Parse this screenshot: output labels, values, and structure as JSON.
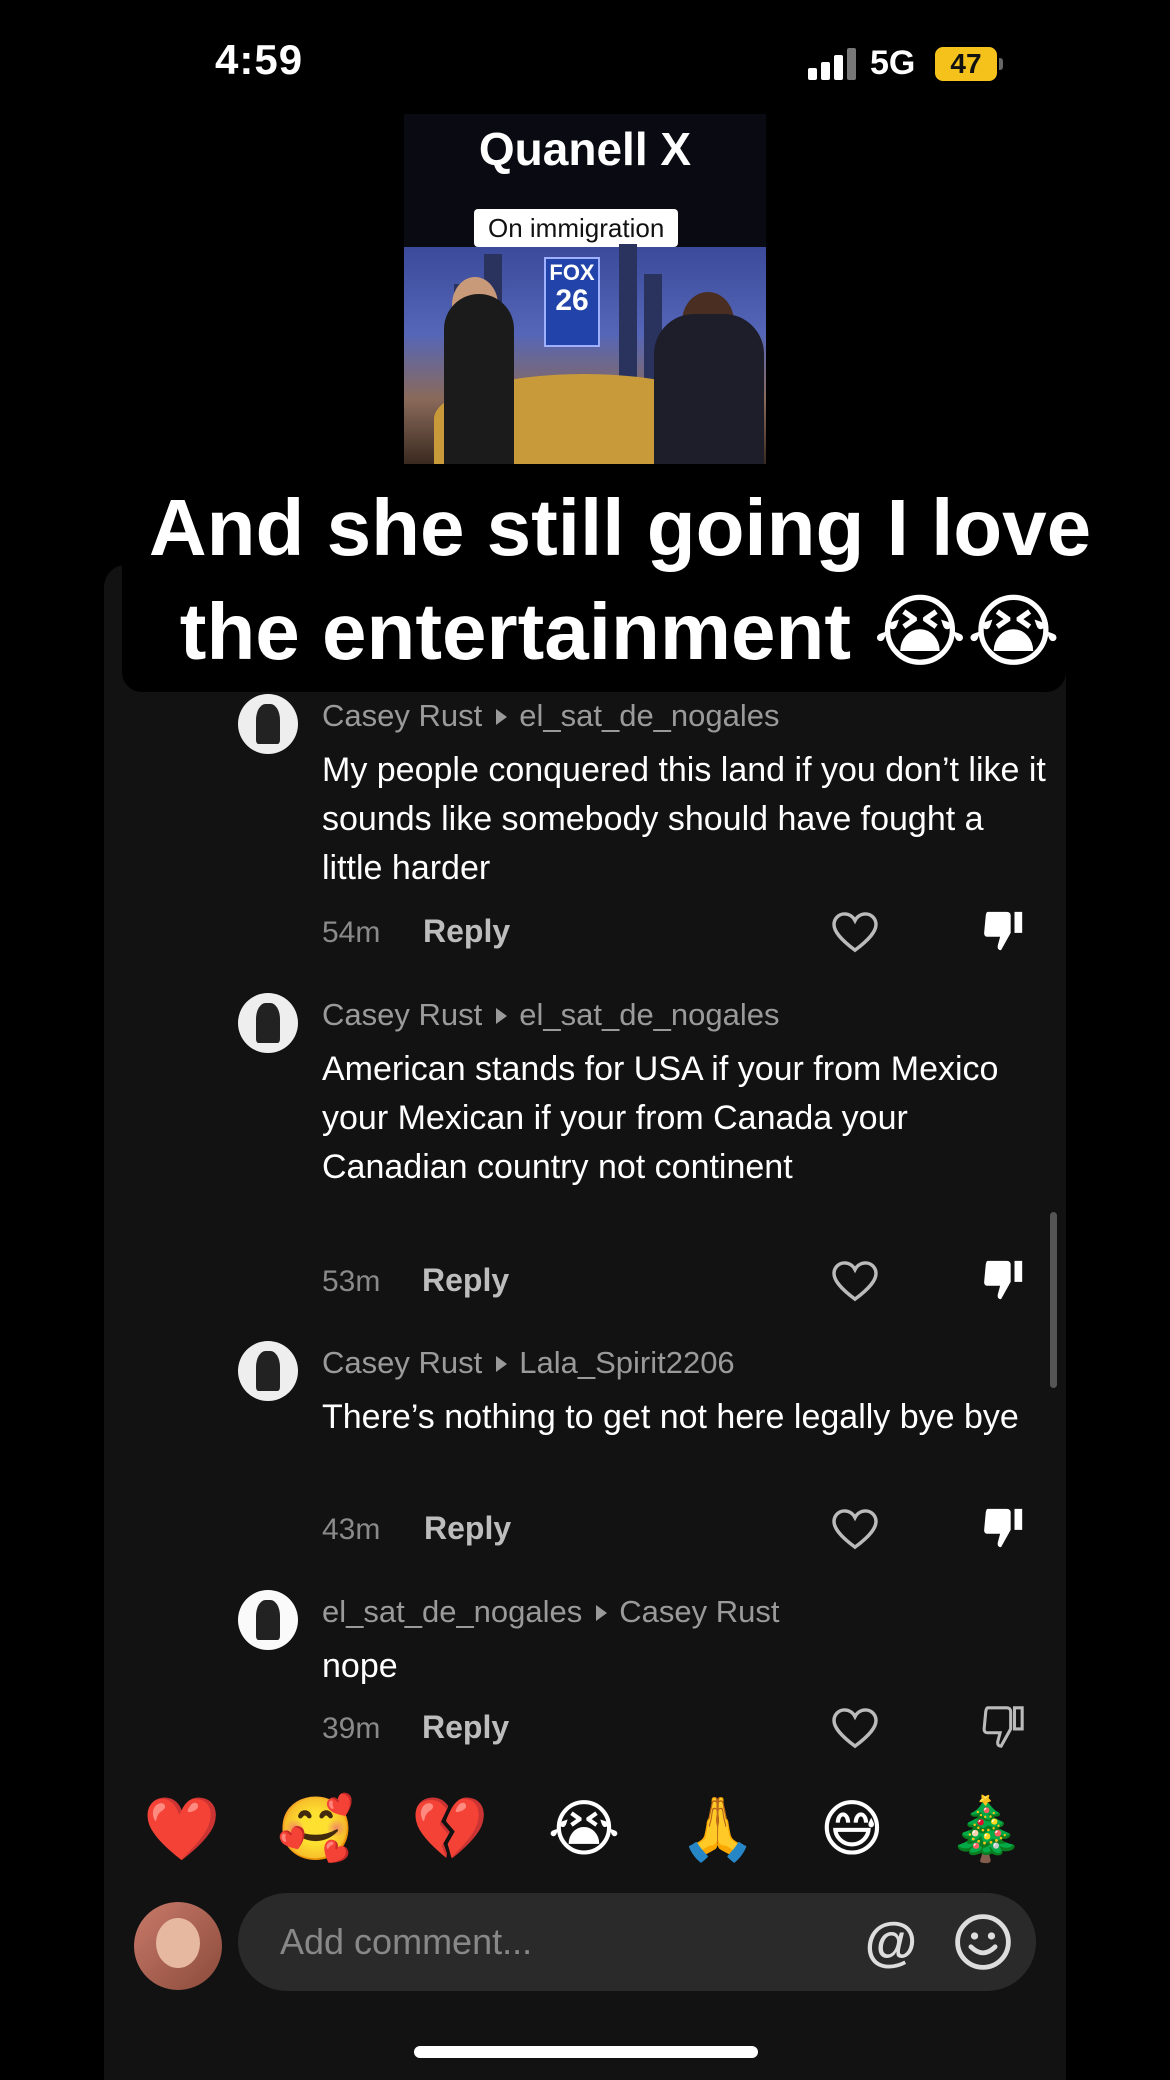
{
  "status_bar": {
    "time": "4:59",
    "network": "5G",
    "battery": "47"
  },
  "video": {
    "title": "Quanell X",
    "tag": "On immigration",
    "station_logo": [
      "FOX",
      "26"
    ]
  },
  "caption": "And she still going I love the entertainment 😭😭",
  "comments": [
    {
      "author": "Casey Rust",
      "reply_to": "el_sat_de_nogales",
      "text": "My people conquered this land if you don’t like it sounds like somebody should have fought a little harder",
      "age": "54m",
      "reply_label": "Reply",
      "avatar_icon": "profile-photo",
      "disliked": true
    },
    {
      "author": "Casey Rust",
      "reply_to": "el_sat_de_nogales",
      "text": "American stands for USA if your from Mexico your Mexican if your from Canada your Canadian country not continent",
      "age": "53m",
      "reply_label": "Reply",
      "avatar_icon": "profile-photo",
      "disliked": true
    },
    {
      "author": "Casey Rust",
      "reply_to": "Lala_Spirit2206",
      "text": "There’s nothing to get not here legally bye bye",
      "age": "43m",
      "reply_label": "Reply",
      "avatar_icon": "profile-photo",
      "disliked": true
    },
    {
      "author": "el_sat_de_nogales",
      "reply_to": "Casey Rust",
      "text": "nope",
      "age": "39m",
      "reply_label": "Reply",
      "avatar_icon": "profile-photo",
      "disliked": false
    }
  ],
  "quick_emojis": [
    "❤️",
    "🥰",
    "💔",
    "😭",
    "🙏",
    "😅",
    "🎄"
  ],
  "composer": {
    "placeholder": "Add comment...",
    "mention_symbol": "@"
  },
  "colors": {
    "background": "#000000",
    "panel": "#121212",
    "battery": "#f4c21a"
  }
}
